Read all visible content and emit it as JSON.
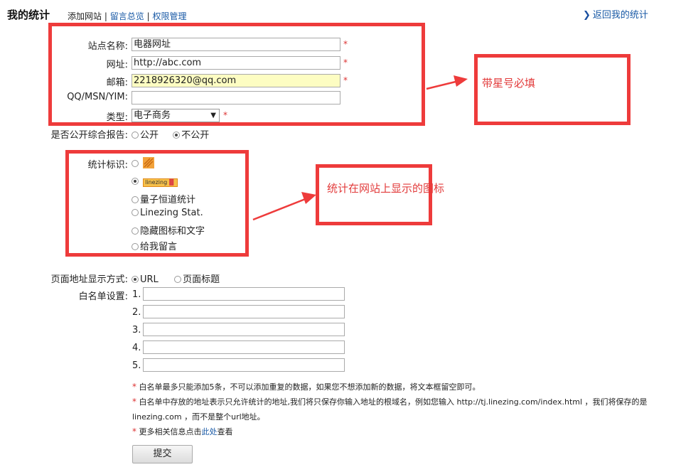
{
  "header": {
    "title": "我的统计",
    "links": [
      "添加网站",
      "留言总览",
      "权限管理"
    ],
    "separator": "|",
    "back_label": "返回我的统计"
  },
  "form": {
    "site_name": {
      "label": "站点名称:",
      "value": "电器网址"
    },
    "url": {
      "label": "网址:",
      "value": "http://abc.com"
    },
    "email": {
      "label": "邮箱:",
      "value": "2218926320@qq.com"
    },
    "im": {
      "label": "QQ/MSN/YIM:",
      "value": ""
    },
    "type": {
      "label": "类型:",
      "value": "电子商务"
    },
    "required_mark": "*",
    "public_report": {
      "label": "是否公开综合报告:",
      "options": [
        "公开",
        "不公开"
      ],
      "selected": "不公开"
    },
    "stat_mark": {
      "label": "统计标识:",
      "logo_text": "linezing",
      "options": [
        "量子恒道统计",
        "Linezing Stat.",
        "隐藏图标和文字",
        "给我留言"
      ]
    },
    "address_mode": {
      "label": "页面地址显示方式:",
      "options": [
        "URL",
        "页面标题"
      ],
      "selected": "URL"
    },
    "whitelist": {
      "label": "白名单设置:",
      "numbers": [
        "1.",
        "2.",
        "3.",
        "4.",
        "5."
      ],
      "values": [
        "",
        "",
        "",
        "",
        ""
      ]
    },
    "notes": [
      "白名单最多只能添加5条，不可以添加重复的数据，如果您不想添加新的数据，将文本框留空即可。",
      "白名单中存放的地址表示只允许统计的地址,我们将只保存你输入地址的根域名，例如您输入 http://tj.linezing.com/index.html ，我们将保存的是",
      "linezing.com ，而不是整个url地址。"
    ],
    "more_info": {
      "prefix": "更多相关信息点击",
      "link": "此处",
      "suffix": "查看"
    },
    "submit_label": "提交"
  },
  "annotations": {
    "required_note": "带星号必填",
    "icon_note": "统计在网站上显示的图标"
  },
  "colors": {
    "annotation_red": "#ee3b3b",
    "link_blue": "#1a5aa6",
    "highlight_field": "#fdfdc2"
  }
}
